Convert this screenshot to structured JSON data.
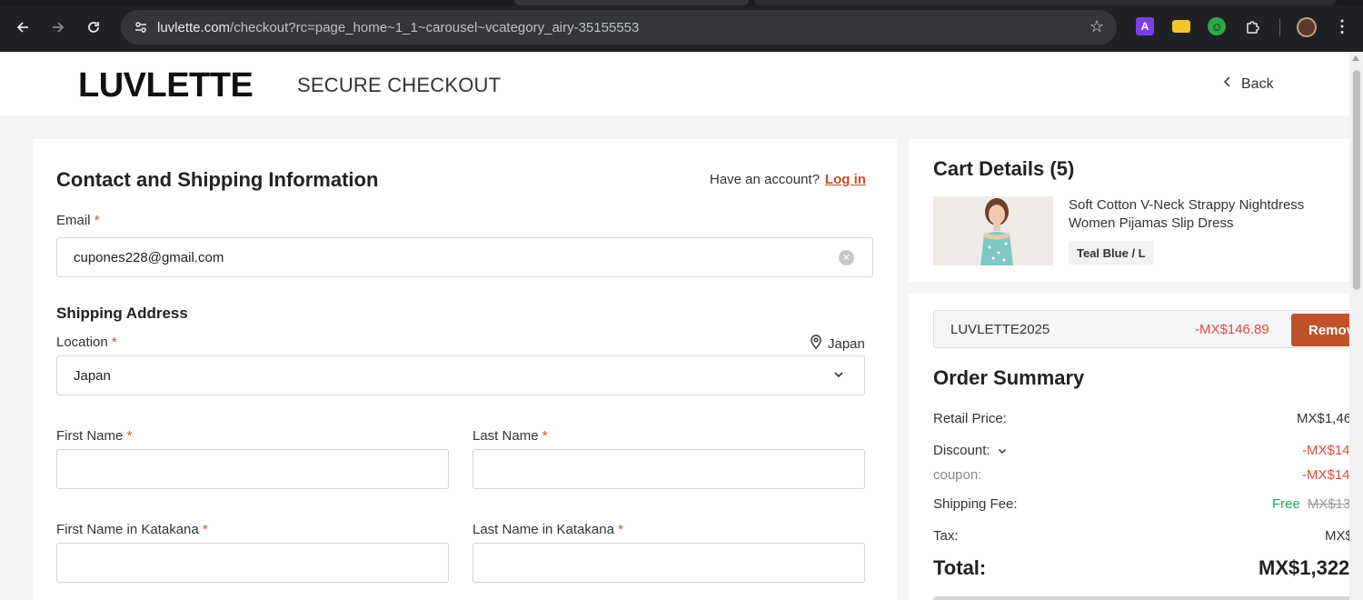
{
  "browser": {
    "url_host": "luvlette.com",
    "url_path": "/checkout?rc=page_home~1_1~carousel~vcategory_airy-35155553",
    "extensions": [
      {
        "name": "ext-a",
        "glyph": "A",
        "color": "#7b3fe4"
      },
      {
        "name": "ext-card",
        "glyph": "",
        "color": "#f4c430"
      },
      {
        "name": "ext-green",
        "glyph": "☺",
        "color": "#2eaa4a"
      }
    ]
  },
  "header": {
    "logo": "LUVLETTE",
    "title": "SECURE CHECKOUT",
    "back_label": "Back"
  },
  "contact": {
    "title": "Contact and Shipping Information",
    "have_account": "Have an account?",
    "login": "Log in",
    "email_label": "Email",
    "email_value": "cupones228@gmail.com",
    "required_mark": "*"
  },
  "shipping": {
    "title": "Shipping Address",
    "location_label": "Location",
    "location_hint": "Japan",
    "location_value": "Japan",
    "first_name_label": "First Name",
    "last_name_label": "Last Name",
    "first_name_kana_label": "First Name in Katakana",
    "last_name_kana_label": "Last Name in Katakana"
  },
  "cart": {
    "title": "Cart Details (5)",
    "item": {
      "name": "Soft Cotton V-Neck Strappy Nightdress Women Pijamas Slip Dress",
      "variant": "Teal Blue / L"
    }
  },
  "coupon": {
    "code": "LUVLETTE2025",
    "amount": "-MX$146.89",
    "remove_label": "Remov"
  },
  "summary": {
    "title": "Order Summary",
    "retail_label": "Retail Price:",
    "retail_value": "MX$1,46",
    "discount_label": "Discount:",
    "discount_value": "-MX$14",
    "coupon_label": "coupon:",
    "coupon_value": "-MX$14",
    "shipping_label": "Shipping Fee:",
    "shipping_free": "Free",
    "shipping_original": "MX$13",
    "tax_label": "Tax:",
    "tax_value": "MX$",
    "total_label": "Total:",
    "total_value": "MX$1,322"
  }
}
